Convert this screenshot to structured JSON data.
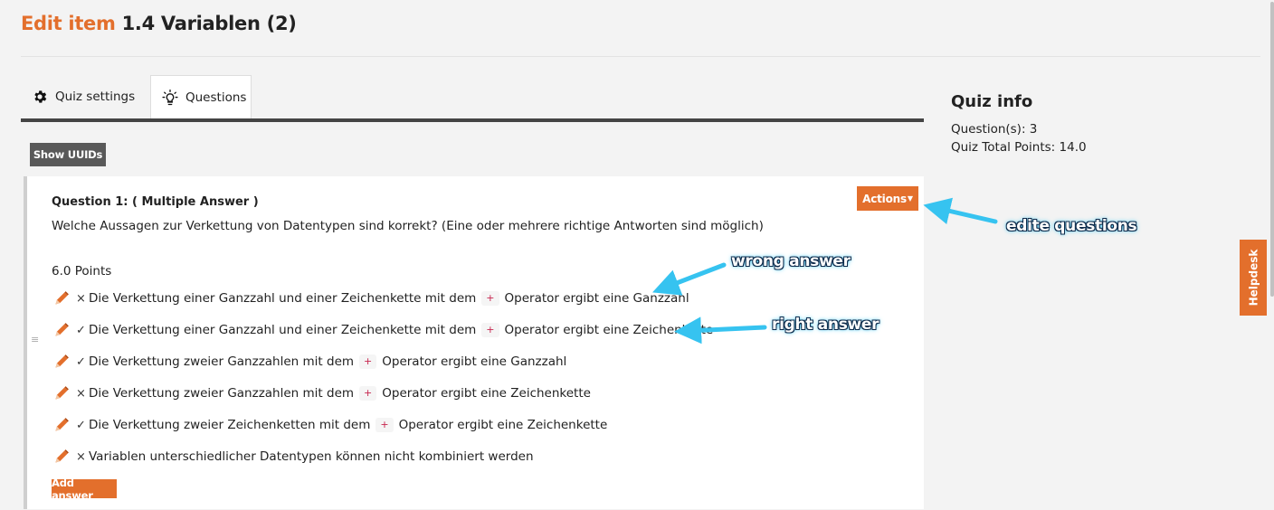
{
  "page": {
    "title_prefix": "Edit item",
    "title_name": "1.4 Variablen (2)"
  },
  "tabs": [
    {
      "label": "Quiz settings",
      "icon": "gear-icon"
    },
    {
      "label": "Questions",
      "icon": "lightbulb-icon"
    }
  ],
  "toolbar": {
    "show_uuids_label": "Show UUIDs"
  },
  "question": {
    "heading": "Question 1: ( Multiple Answer )",
    "text": "Welche Aussagen zur Verkettung von Datentypen sind korrekt? (Eine oder mehrere richtige Antworten sind möglich)",
    "points": "6.0 Points",
    "actions_label": "Actions",
    "add_answer_label": "Add answer",
    "drag_handle": "≡",
    "answers": [
      {
        "mark": "×",
        "before": "Die Verkettung einer Ganzzahl und einer Zeichenkette mit dem",
        "op": "+",
        "after": "Operator ergibt eine Ganzzahl"
      },
      {
        "mark": "✓",
        "before": "Die Verkettung einer Ganzzahl und einer Zeichenkette mit dem",
        "op": "+",
        "after": "Operator ergibt eine Zeichenkette"
      },
      {
        "mark": "✓",
        "before": "Die Verkettung zweier Ganzzahlen mit dem",
        "op": "+",
        "after": "Operator ergibt eine Ganzzahl"
      },
      {
        "mark": "×",
        "before": "Die Verkettung zweier Ganzzahlen mit dem",
        "op": "+",
        "after": "Operator ergibt eine Zeichenkette"
      },
      {
        "mark": "✓",
        "before": "Die Verkettung zweier Zeichenketten mit dem",
        "op": "+",
        "after": "Operator ergibt eine Zeichenkette"
      },
      {
        "mark": "×",
        "before": "Variablen unterschiedlicher Datentypen können nicht kombiniert werden",
        "op": "",
        "after": ""
      }
    ]
  },
  "quiz_info": {
    "title": "Quiz info",
    "questions": "Question(s): 3",
    "total_points": "Quiz Total Points: 14.0"
  },
  "helpdesk_label": "Helpdesk",
  "annotations": {
    "edit_questions": "edite questions",
    "wrong_answer": "wrong answer",
    "right_answer": "right answer"
  },
  "colors": {
    "accent": "#e36f2c",
    "callout_arrow": "#36c3f0",
    "dark_button": "#595959"
  }
}
